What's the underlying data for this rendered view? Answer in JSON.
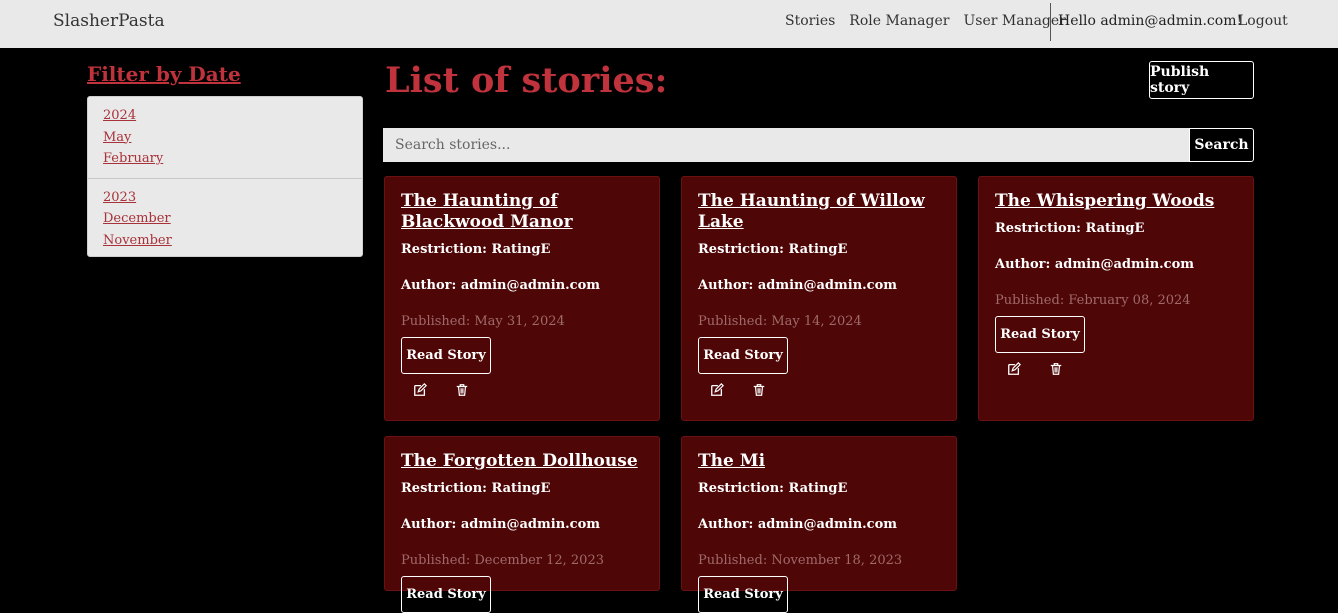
{
  "navbar": {
    "brand": "SlasherPasta",
    "links": [
      "Stories",
      "Role Manager",
      "User Manager"
    ],
    "greeting": "Hello admin@admin.com!",
    "logout": "Logout"
  },
  "sidebar": {
    "title": "Filter by Date",
    "years": [
      {
        "year": "2024",
        "months": [
          "May",
          "February"
        ]
      },
      {
        "year": "2023",
        "months": [
          "December",
          "November"
        ]
      }
    ]
  },
  "main": {
    "title": "List of stories:",
    "publish_label": "Publish story",
    "search_placeholder": "Search stories...",
    "search_label": "Search"
  },
  "stories": [
    {
      "title": "The Haunting of Blackwood Manor",
      "restriction": "Restriction: RatingE",
      "author": "Author: admin@admin.com",
      "published": "Published: May 31, 2024",
      "read_label": "Read Story"
    },
    {
      "title": "The Haunting of Willow Lake",
      "restriction": "Restriction: RatingE",
      "author": "Author: admin@admin.com",
      "published": "Published: May 14, 2024",
      "read_label": "Read Story"
    },
    {
      "title": "The Whispering Woods",
      "restriction": "Restriction: RatingE",
      "author": "Author: admin@admin.com",
      "published": "Published: February 08, 2024",
      "read_label": "Read Story"
    },
    {
      "title": "The Forgotten Dollhouse",
      "restriction": "Restriction: RatingE",
      "author": "Author: admin@admin.com",
      "published": "Published: December 12, 2023",
      "read_label": "Read Story"
    },
    {
      "title": "The Mi",
      "restriction": "Restriction: RatingE",
      "author": "Author: admin@admin.com",
      "published": "Published: November 18, 2023",
      "read_label": "Read Story"
    }
  ],
  "icons": {
    "edit": "edit-icon",
    "delete": "trash-icon"
  },
  "colors": {
    "accent": "#c0323c",
    "card_bg": "#4e0606",
    "navbar_bg": "#e9e9e9"
  }
}
